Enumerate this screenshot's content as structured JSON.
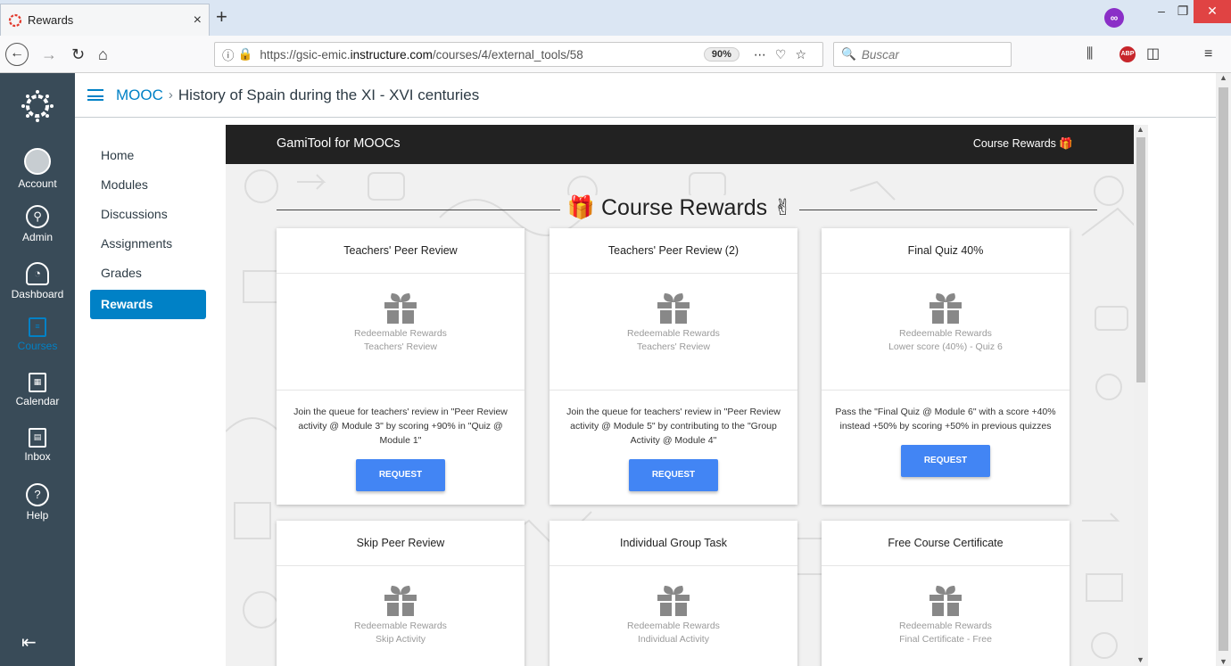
{
  "browser": {
    "tab_title": "Rewards",
    "tab_close": "×",
    "new_tab": "+",
    "url_prefix": "https://gsic-emic.",
    "url_domain": "instructure.com",
    "url_path": "/courses/4/external_tools/58",
    "zoom": "90%",
    "search_placeholder": "Buscar",
    "abp": "ABP",
    "menu": "≡"
  },
  "global_nav": {
    "items": [
      {
        "label": "Account"
      },
      {
        "label": "Admin"
      },
      {
        "label": "Dashboard"
      },
      {
        "label": "Courses"
      },
      {
        "label": "Calendar"
      },
      {
        "label": "Inbox"
      },
      {
        "label": "Help"
      }
    ]
  },
  "breadcrumb": {
    "course": "MOOC",
    "separator": "›",
    "page": "History of Spain during the XI - XVI centuries"
  },
  "course_nav": {
    "items": [
      "Home",
      "Modules",
      "Discussions",
      "Assignments",
      "Grades",
      "Rewards"
    ],
    "active": "Rewards"
  },
  "gamitool": {
    "brand": "GamiTool for MOOCs",
    "header_link": "Course Rewards",
    "section_title": "Course Rewards",
    "cards": [
      {
        "title": "Teachers' Peer Review",
        "category": "Redeemable Rewards",
        "subtitle": "Teachers' Review",
        "description": "Join the queue for teachers' review in \"Peer Review activity @ Module 3\" by scoring +90% in \"Quiz @ Module 1\"",
        "button": "REQUEST"
      },
      {
        "title": "Teachers' Peer Review (2)",
        "category": "Redeemable Rewards",
        "subtitle": "Teachers' Review",
        "description": "Join the queue for teachers' review in \"Peer Review activity @ Module 5\" by contributing to the \"Group Activity @ Module 4\"",
        "button": "REQUEST"
      },
      {
        "title": "Final Quiz 40%",
        "category": "Redeemable Rewards",
        "subtitle": "Lower score (40%) - Quiz 6",
        "description": "Pass the \"Final Quiz @ Module 6\" with a score +40% instead +50% by scoring +50% in previous quizzes",
        "button": "REQUEST"
      },
      {
        "title": "Skip Peer Review",
        "category": "Redeemable Rewards",
        "subtitle": "Skip Activity",
        "description": "",
        "button": ""
      },
      {
        "title": "Individual Group Task",
        "category": "Redeemable Rewards",
        "subtitle": "Individual Activity",
        "description": "",
        "button": ""
      },
      {
        "title": "Free Course Certificate",
        "category": "Redeemable Rewards",
        "subtitle": "Final Certificate - Free",
        "description": "",
        "button": ""
      }
    ]
  },
  "colors": {
    "canvas_nav": "#394b58",
    "canvas_blue": "#0081c6",
    "button_blue": "#4285f4",
    "gami_header": "#222222"
  }
}
